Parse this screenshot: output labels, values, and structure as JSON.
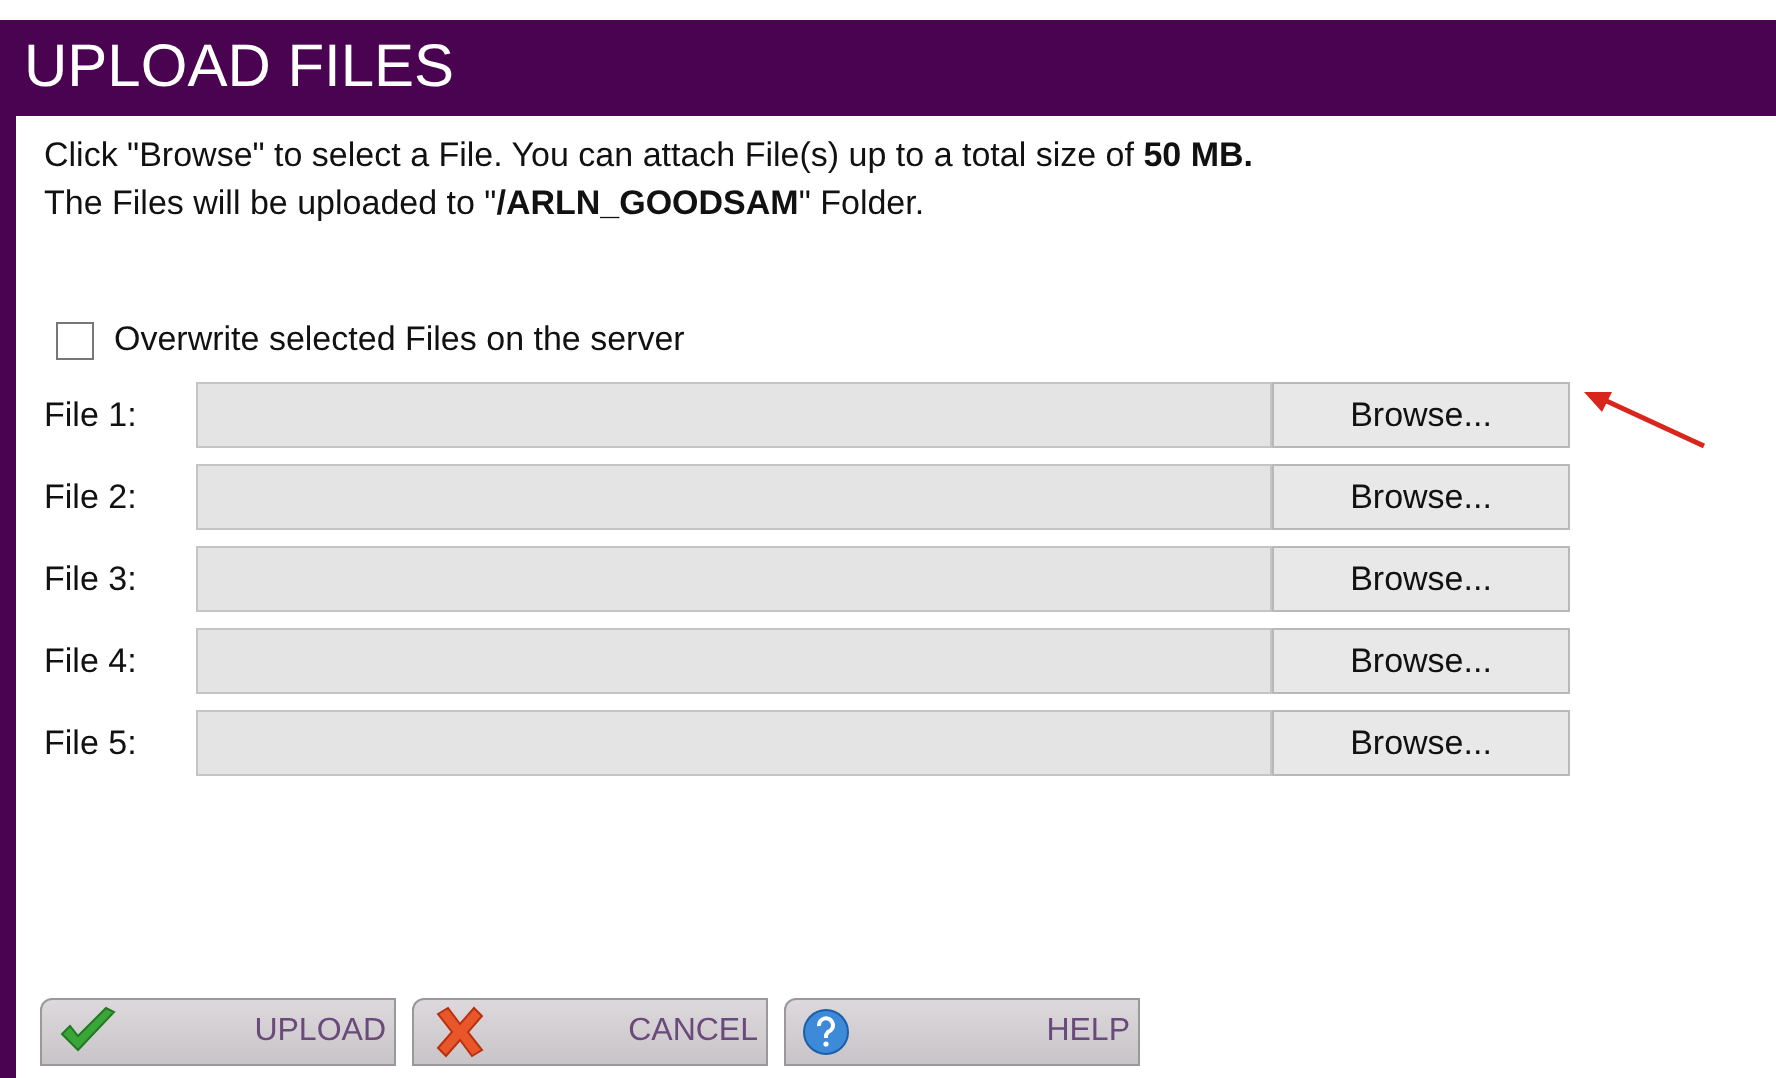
{
  "title": "UPLOAD FILES",
  "instructions": [
    "Click \"Browse\" to select a File. You can attach File(s) up to a total size of **50 MB.**",
    "The Files will be uploaded to \"**/ARLN_GOODSAM**\" Folder."
  ],
  "overwrite": {
    "label": "Overwrite selected Files on the server",
    "checked": false
  },
  "files": [
    {
      "label": "File 1:",
      "button": "Browse...",
      "pointer": true
    },
    {
      "label": "File 2:",
      "button": "Browse...",
      "pointer": false
    },
    {
      "label": "File 3:",
      "button": "Browse...",
      "pointer": false
    },
    {
      "label": "File 4:",
      "button": "Browse...",
      "pointer": false
    },
    {
      "label": "File 5:",
      "button": "Browse...",
      "pointer": false
    }
  ],
  "actions": [
    {
      "kind": "upload",
      "label": "UPLOAD"
    },
    {
      "kind": "cancel",
      "label": "CANCEL"
    },
    {
      "kind": "help",
      "label": "HELP"
    }
  ]
}
